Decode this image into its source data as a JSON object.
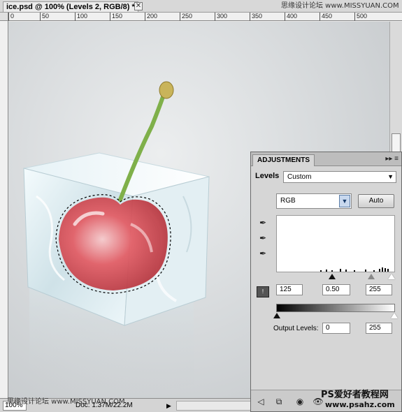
{
  "document": {
    "tab_title": "ice.psd @ 100% (Levels 2, RGB/8) *",
    "close_glyph": "✕",
    "ruler_h_labels": [
      "0",
      "50",
      "100",
      "150",
      "200",
      "250",
      "300",
      "350",
      "400",
      "450",
      "500"
    ]
  },
  "watermarks": {
    "top": "思缘设计论坛 www.MISSYUAN.COM",
    "bottom": "思缘设计论坛 www.MISSYUAN.COM",
    "panel_l1": "PS爱好者教程网",
    "panel_l2": "www.psahz.com"
  },
  "status_bar": {
    "zoom": "100%",
    "doc_info": "Doc: 1.37M/22.2M",
    "arrow_glyph": "▶"
  },
  "adjustments": {
    "tab_label": "ADJUSTMENTS",
    "menu_glyph": "▸▸ ≡",
    "levels_label": "Levels",
    "preset_value": "Custom",
    "dropdown_glyph": "▼",
    "channel_value": "RGB",
    "auto_label": "Auto",
    "input_black": "125",
    "input_gamma": "0.50",
    "input_white": "255",
    "output_label": "Output Levels:",
    "output_black": "0",
    "output_white": "255",
    "clip_glyph": "!",
    "icons": {
      "eyedropper": "✒",
      "back": "◁",
      "view": "⧉",
      "eye": "◉",
      "visibility": "👁"
    }
  }
}
